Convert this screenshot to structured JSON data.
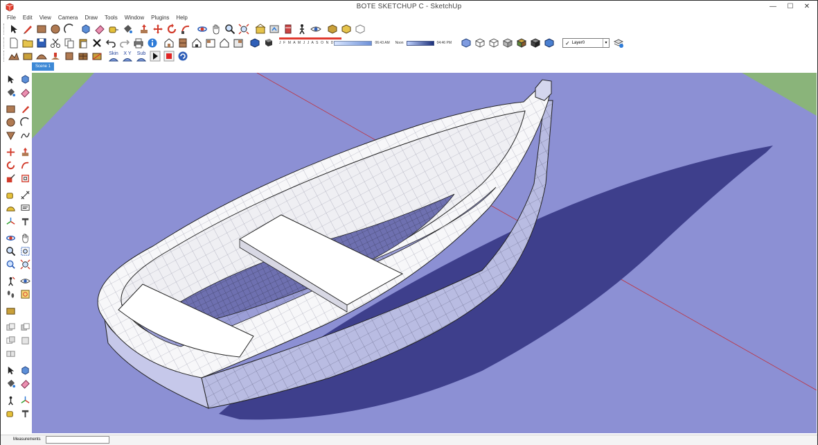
{
  "window": {
    "title": "BOTE SKETCHUP C - SketchUp",
    "minimize": "—",
    "maximize": "☐",
    "close": "✕"
  },
  "menu": [
    "File",
    "Edit",
    "View",
    "Camera",
    "Draw",
    "Tools",
    "Window",
    "Plugins",
    "Help"
  ],
  "shadows": {
    "months": "J F M A M J J A S O N D",
    "time_start": "06:43 AM",
    "time_mid": "Noon",
    "time_end": "04:46 PM"
  },
  "plugins": {
    "skin_label": "Skin",
    "xyz_label": "X Y",
    "sub_label": "Sub"
  },
  "layer": {
    "current": "Layer0"
  },
  "scene_tab": "Scene 1",
  "status": {
    "measurements_label": "Measurements",
    "measurements_value": ""
  },
  "colors": {
    "ground": "#8c90d4",
    "grass": "#8ab47a",
    "hull_white": "#f7f7f9",
    "hull_shade": "#b9bce2",
    "shadow": "#3e3f8c",
    "edge": "#222222",
    "axis_red": "#c0303a"
  }
}
